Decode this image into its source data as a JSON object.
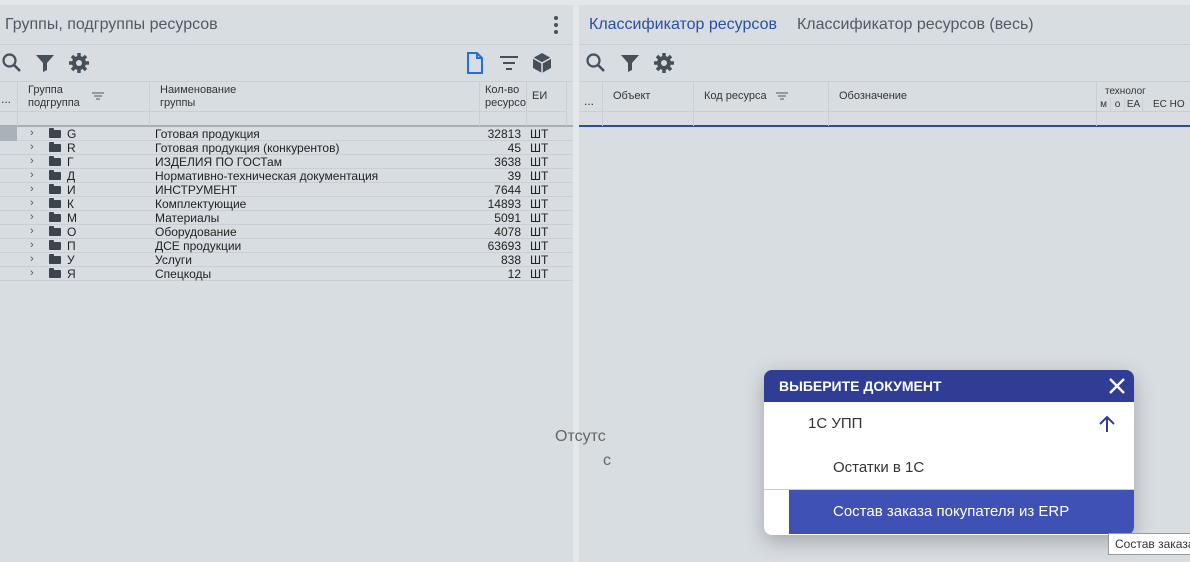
{
  "left_panel": {
    "title": "Группы, подгруппы ресурсов",
    "columns": {
      "dots": "...",
      "group": "Группа\nподгруппа",
      "name": "Наименование\nгруппы",
      "count": "Кол-во\nресурсов",
      "unit": "ЕИ"
    },
    "rows": [
      {
        "code": "G",
        "name": "Готовая продукция",
        "count": "32813",
        "unit": "ШТ"
      },
      {
        "code": "R",
        "name": "Готовая продукция (конкурентов)",
        "count": "45",
        "unit": "ШТ"
      },
      {
        "code": "Г",
        "name": "ИЗДЕЛИЯ ПО ГОСТам",
        "count": "3638",
        "unit": "ШТ"
      },
      {
        "code": "Д",
        "name": "Нормативно-техническая документация",
        "count": "39",
        "unit": "ШТ"
      },
      {
        "code": "И",
        "name": "ИНСТРУМЕНТ",
        "count": "7644",
        "unit": "ШТ"
      },
      {
        "code": "К",
        "name": "Комплектующие",
        "count": "14893",
        "unit": "ШТ"
      },
      {
        "code": "М",
        "name": "Материалы",
        "count": "5091",
        "unit": "ШТ"
      },
      {
        "code": "О",
        "name": "Оборудование",
        "count": "4078",
        "unit": "ШТ"
      },
      {
        "code": "П",
        "name": "ДСЕ продукции",
        "count": "63693",
        "unit": "ШТ"
      },
      {
        "code": "У",
        "name": "Услуги",
        "count": "838",
        "unit": "ШТ"
      },
      {
        "code": "Я",
        "name": "Спецкоды",
        "count": "12",
        "unit": "ШТ"
      }
    ]
  },
  "right_panel": {
    "tabs": [
      {
        "label": "Классификатор ресурсов",
        "active": true
      },
      {
        "label": "Классификатор ресурсов (весь)",
        "active": false
      }
    ],
    "columns": {
      "dots": "...",
      "object": "Объект",
      "code": "Код ресурса",
      "designation": "Обозначение",
      "tech": "технолог",
      "m": "м",
      "o": "о",
      "ea": "ЕА",
      "ec": "ЕС НО"
    },
    "empty_line1": "Отсутс",
    "empty_line2": "с"
  },
  "dialog": {
    "title": "ВЫБЕРИТЕ ДОКУМЕНТ",
    "group_label": "1С УПП",
    "items": [
      {
        "label": "Остатки в 1С",
        "selected": false
      },
      {
        "label": "Состав заказа покупателя из ERP",
        "selected": true
      }
    ]
  },
  "tooltip": "Состав заказа",
  "colors": {
    "accent": "#2a4fa0",
    "dialog_header": "#2f3d94",
    "selected_item": "#3f51b5",
    "panel_bg": "#d8dde2"
  }
}
